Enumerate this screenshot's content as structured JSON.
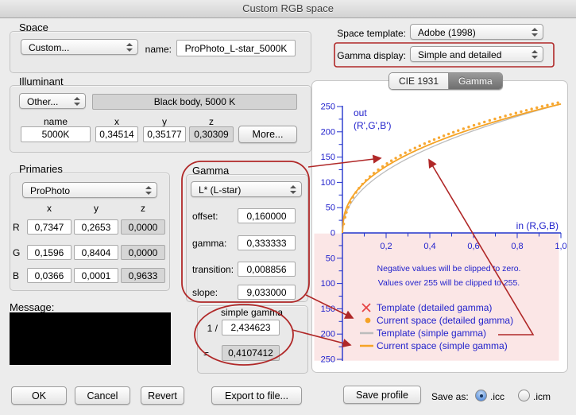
{
  "window": {
    "title": "Custom RGB space"
  },
  "space": {
    "label": "Space",
    "popup_value": "Custom...",
    "name_label": "name:",
    "name_value": "ProPhoto_L-star_5000K"
  },
  "template_row": {
    "label": "Space template:",
    "value": "Adobe (1998)"
  },
  "gamma_display_row": {
    "label": "Gamma display:",
    "value": "Simple and detailed"
  },
  "illuminant": {
    "label": "Illuminant",
    "popup_value": "Other...",
    "description": "Black body, 5000 K",
    "headers": {
      "name": "name",
      "x": "x",
      "y": "y",
      "z": "z"
    },
    "name_value": "5000K",
    "x_value": "0,34514",
    "y_value": "0,35177",
    "z_value": "0,30309",
    "more_label": "More..."
  },
  "primaries": {
    "label": "Primaries",
    "popup_value": "ProPhoto",
    "headers": {
      "x": "x",
      "y": "y",
      "z": "z"
    },
    "rows": [
      {
        "label": "R",
        "x": "0,7347",
        "y": "0,2653",
        "z": "0,0000"
      },
      {
        "label": "G",
        "x": "0,1596",
        "y": "0,8404",
        "z": "0,0000"
      },
      {
        "label": "B",
        "x": "0,0366",
        "y": "0,0001",
        "z": "0,9633"
      }
    ]
  },
  "gamma": {
    "label": "Gamma",
    "popup_value": "L* (L-star)",
    "fields": [
      {
        "label": "offset:",
        "value": "0,160000"
      },
      {
        "label": "gamma:",
        "value": "0,333333"
      },
      {
        "label": "transition:",
        "value": "0,008856"
      },
      {
        "label": "slope:",
        "value": "9,033000"
      }
    ]
  },
  "simple_gamma": {
    "label": "simple gamma",
    "numerator_label": "1 /",
    "value": "2,434623",
    "equals_label": "=",
    "result": "0,4107412"
  },
  "message": {
    "label": "Message:"
  },
  "buttons": {
    "ok": "OK",
    "cancel": "Cancel",
    "revert": "Revert",
    "export": "Export to file...",
    "save_profile": "Save profile"
  },
  "save_as": {
    "label": "Save as:",
    "options": [
      {
        "label": ".icc",
        "selected": true
      },
      {
        "label": ".icm",
        "selected": false
      }
    ]
  },
  "tabs": [
    {
      "label": "CIE 1931",
      "selected": false
    },
    {
      "label": "Gamma",
      "selected": true
    }
  ],
  "chart_data": {
    "type": "line",
    "x_axis": {
      "title": "in (R,G,B)",
      "min": 0,
      "max": 1,
      "minor_step": 0.1,
      "labeled_ticks": [
        {
          "v": 0.2,
          "label": "0,2"
        },
        {
          "v": 0.4,
          "label": "0,4"
        },
        {
          "v": 0.6,
          "label": "0,6"
        },
        {
          "v": 0.8,
          "label": "0,8"
        },
        {
          "v": 1.0,
          "label": "1,0"
        }
      ]
    },
    "y_axis": {
      "title_lines": [
        "out",
        "(R',G',B')"
      ],
      "max": 250,
      "label_step": 50,
      "minor_step": 25,
      "mirrored_below_zero": true
    },
    "out_range": [
      0,
      255
    ],
    "annotations": [
      "Negative values will be clipped to zero.",
      "Values over 255 will be clipped to 255."
    ],
    "legend": [
      {
        "marker": "cross",
        "color": "#e64545",
        "label": "Template (detailed gamma)"
      },
      {
        "marker": "dot",
        "color": "#f5a326",
        "label": "Current space (detailed gamma)"
      },
      {
        "marker": "line",
        "color": "#bcbcbc",
        "label": "Template (simple gamma)"
      },
      {
        "marker": "line",
        "color": "#f5a326",
        "label": "Current space (simple gamma)"
      }
    ],
    "series": [
      {
        "name": "Template (simple gamma)",
        "curve": "power",
        "gamma_reciprocal": 2.2,
        "style": "line",
        "color": "#bcbcbc",
        "width": 1.3
      },
      {
        "name": "Current space (simple gamma)",
        "curve": "power",
        "gamma_reciprocal": 2.434623,
        "style": "line",
        "color": "#f5a326",
        "width": 1.8
      },
      {
        "name": "Current space (detailed gamma)",
        "curve": "lstar",
        "offset": 0.16,
        "gamma": 0.333333,
        "transition": 0.008856,
        "slope": 9.033,
        "style": "dots",
        "color": "#f7a832",
        "dot_radius": 1.7
      }
    ],
    "clip_region_color": "#fbe6e6",
    "axis_color": "#2233cc",
    "text_color": "#2222cc"
  }
}
